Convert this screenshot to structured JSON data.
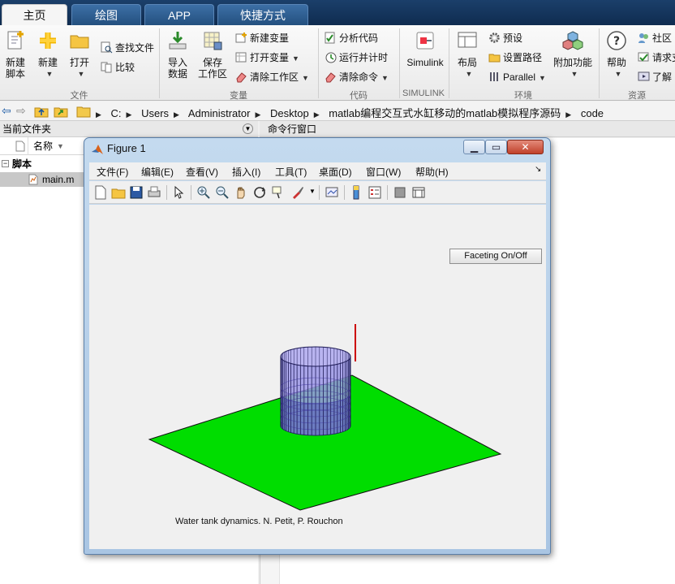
{
  "ribbon": {
    "tabs": [
      "主页",
      "绘图",
      "APP",
      "快捷方式"
    ],
    "active_tab": "主页",
    "groups": {
      "file": "文件",
      "variable": "变量",
      "code": "代码",
      "simulink": "SIMULINK",
      "environment": "环境",
      "resources": "资源"
    },
    "buttons": {
      "new_script": "新建\n脚本",
      "new": "新建",
      "open": "打开",
      "find_files": "查找文件",
      "compare": "比较",
      "import_data": "导入\n数据",
      "save_workspace": "保存\n工作区",
      "new_variable": "新建变量",
      "open_variable": "打开变量",
      "clear_workspace": "清除工作区",
      "analyze_code": "分析代码",
      "run_and_time": "运行并计时",
      "clear_commands": "清除命令",
      "simulink": "Simulink",
      "layout": "布局",
      "preferences": "预设",
      "set_path": "设置路径",
      "parallel": "Parallel",
      "addons": "附加功能",
      "help": "帮助",
      "community": "社区",
      "request_support": "请求支",
      "learn": "了解"
    }
  },
  "address": {
    "crumbs": [
      "C:",
      "Users",
      "Administrator",
      "Desktop",
      "matlab编程交互式水缸移动的matlab模拟程序源码",
      "code"
    ]
  },
  "file_panel": {
    "title": "当前文件夹",
    "column_name": "名称",
    "folder": "脚本",
    "file": "main.m"
  },
  "command_window": {
    "title": "命令行窗口"
  },
  "figure": {
    "title": "Figure 1",
    "menus": [
      "文件(F)",
      "编辑(E)",
      "查看(V)",
      "插入(I)",
      "工具(T)",
      "桌面(D)",
      "窗口(W)",
      "帮助(H)"
    ],
    "facet_button": "Faceting On/Off",
    "caption": "Water tank dynamics. N. Petit, P. Rouchon"
  },
  "colors": {
    "ground": "#00dd00",
    "tank": "#9b96e6",
    "tank_edge": "#1d1a55",
    "marker": "#cc0000",
    "titlebar": "#1b3f6a"
  }
}
